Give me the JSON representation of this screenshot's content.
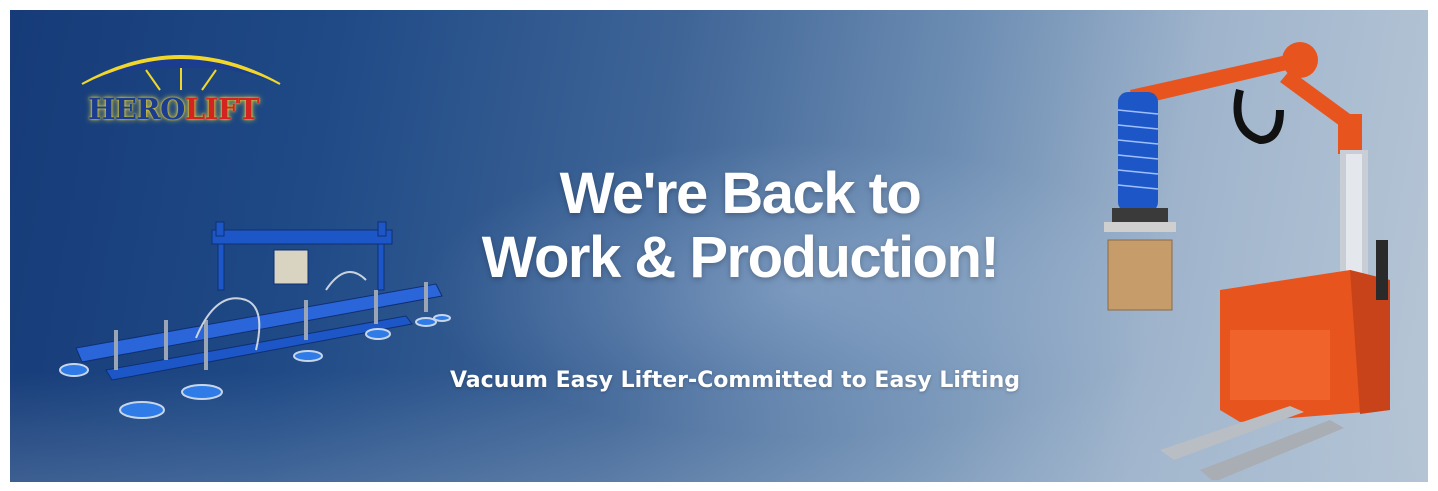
{
  "logo": {
    "part1": "HERO",
    "part2": "LIFT"
  },
  "headline": {
    "line1": "We're Back to",
    "line2": "Work & Production!"
  },
  "subtitle": "Vacuum Easy Lifter-Committed to Easy Lifting",
  "colors": {
    "background_left": "#163b78",
    "background_right": "#b7c6d6",
    "logo_blue": "#1c3d8f",
    "logo_red": "#d32420",
    "logo_glow": "#f6df35",
    "machine_orange": "#e8541e",
    "lifter_blue": "#1d57c7"
  },
  "icons": [
    "logo-arch-icon",
    "vacuum-tube-lifter-image",
    "beam-vacuum-lifter-image"
  ]
}
